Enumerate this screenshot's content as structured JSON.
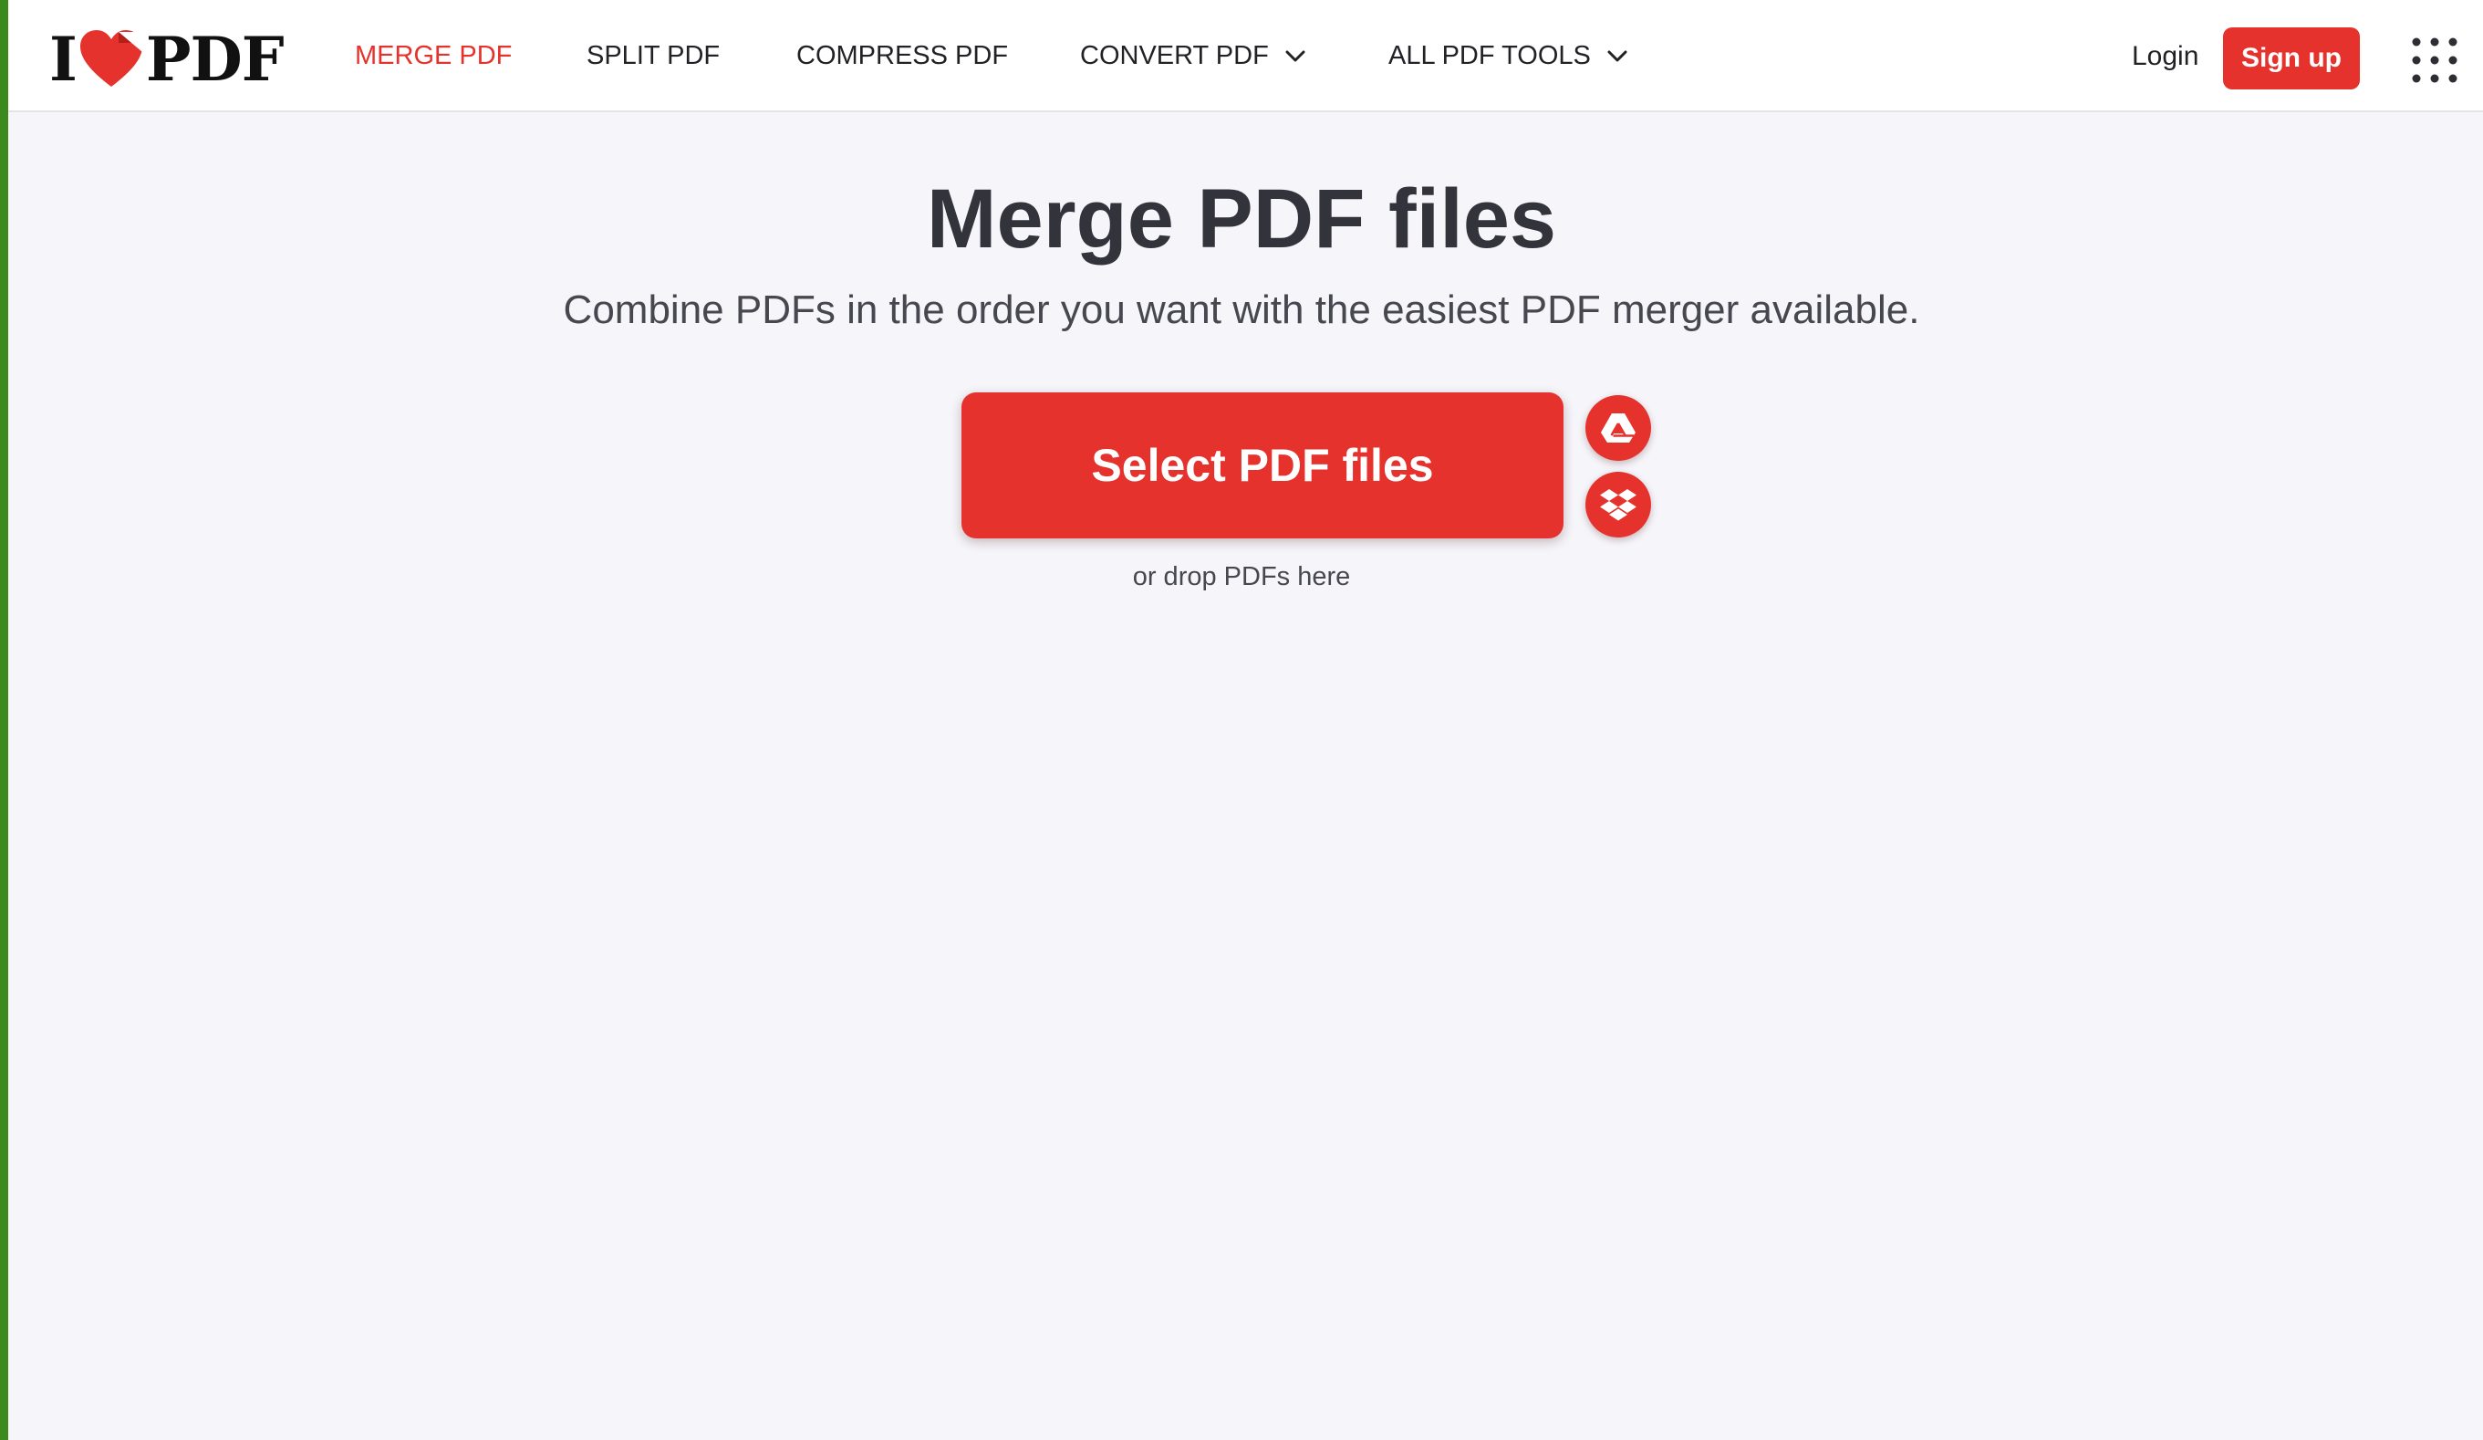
{
  "header": {
    "logo": {
      "left_text": "I",
      "right_text": "PDF",
      "icon": "heart-icon"
    },
    "nav": [
      {
        "label": "MERGE PDF",
        "active": true
      },
      {
        "label": "SPLIT PDF",
        "active": false
      },
      {
        "label": "COMPRESS PDF",
        "active": false
      },
      {
        "label": "CONVERT PDF",
        "active": false,
        "dropdown": true
      },
      {
        "label": "ALL PDF TOOLS",
        "active": false,
        "dropdown": true
      }
    ],
    "login_label": "Login",
    "signup_label": "Sign up",
    "apps_icon": "apps-grid-icon"
  },
  "main": {
    "title": "Merge PDF files",
    "subtitle": "Combine PDFs in the order you want with the easiest PDF merger available.",
    "select_button_label": "Select PDF files",
    "cloud_sources": [
      "google-drive-icon",
      "dropbox-icon"
    ],
    "drop_hint": "or drop PDFs here"
  },
  "colors": {
    "brand_red": "#e5322d",
    "background": "#f5f5fa",
    "header_bg": "#ffffff",
    "text_dark": "#33333b"
  }
}
